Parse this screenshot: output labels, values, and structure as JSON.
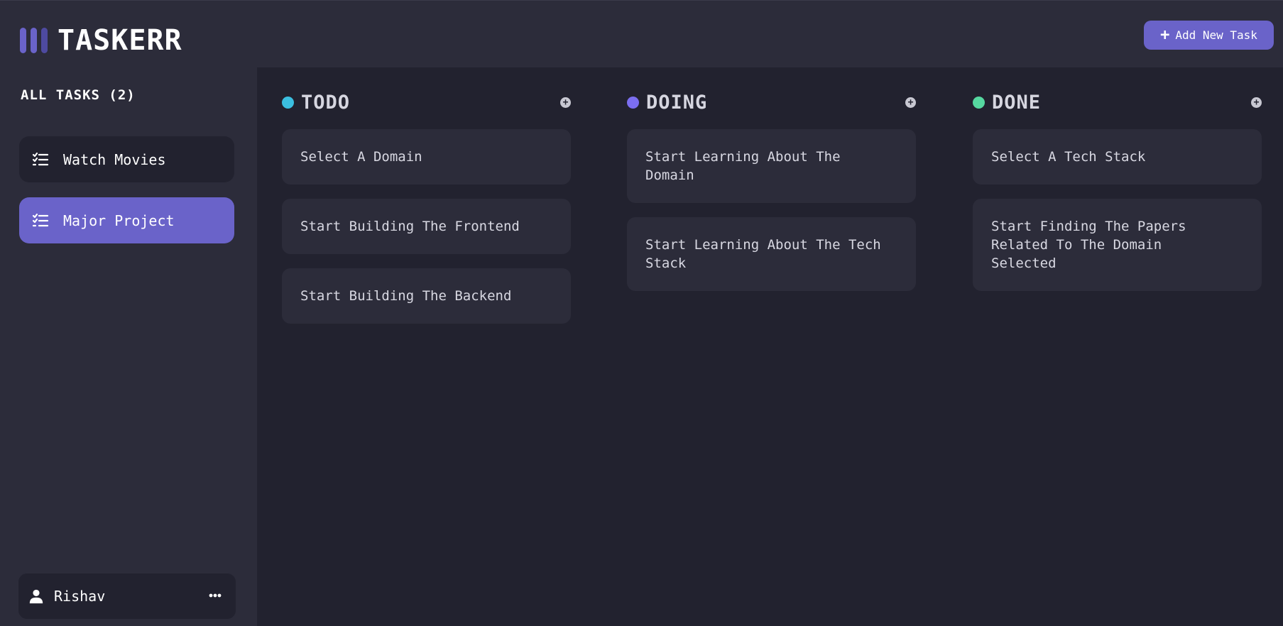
{
  "app": {
    "logo_text": "TASKERR",
    "logo_colors": [
      "#6a63c9",
      "#6a63c9",
      "#4e4aa0"
    ],
    "accent": "#6a63c9"
  },
  "header": {
    "add_task_icon": "plus-icon",
    "add_task_label": "Add New Task"
  },
  "sidebar": {
    "heading": "ALL TASKS (2)",
    "boards": [
      {
        "label": "Watch Movies",
        "icon": "checklist-icon",
        "active": false
      },
      {
        "label": "Major Project",
        "icon": "checklist-icon",
        "active": true
      }
    ],
    "user": {
      "icon": "user-icon",
      "name": "Rishav",
      "menu_icon": "ellipsis-icon"
    }
  },
  "board": {
    "columns": [
      {
        "title": "TODO",
        "color": "#3bbfe0",
        "add_icon": "plus-circle-icon",
        "cards": [
          "Select A Domain",
          "Start Building The Frontend",
          "Start Building The Backend"
        ]
      },
      {
        "title": "DOING",
        "color": "#7b6ef0",
        "add_icon": "plus-circle-icon",
        "cards": [
          "Start Learning About The Domain",
          "Start Learning About The Tech Stack"
        ]
      },
      {
        "title": "DONE",
        "color": "#56d8a0",
        "add_icon": "plus-circle-icon",
        "cards": [
          "Select A Tech Stack",
          "Start Finding The Papers Related To The Domain Selected"
        ]
      }
    ]
  }
}
